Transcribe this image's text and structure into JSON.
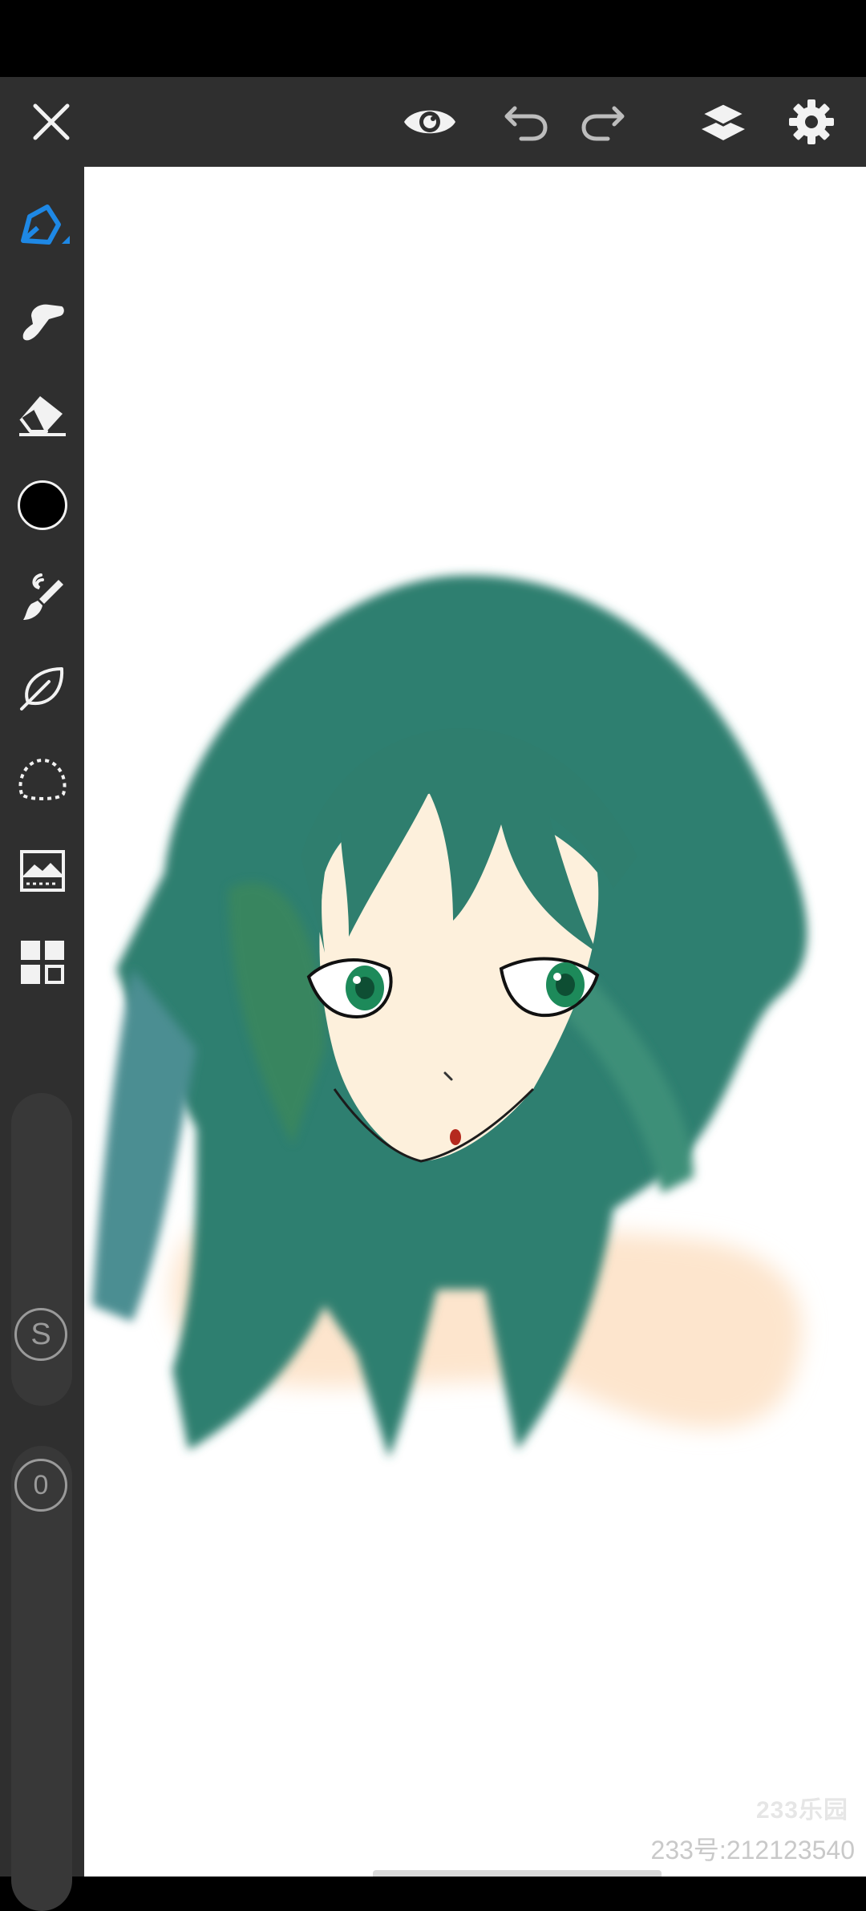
{
  "app": {
    "accent_color": "#1e88e5",
    "current_color": "#000000"
  },
  "top_bar": {
    "icons": [
      "close-icon",
      "eye-icon",
      "undo-icon",
      "redo-icon",
      "layers-icon",
      "gear-icon"
    ]
  },
  "side_tools": {
    "icons": [
      "pencil-icon",
      "smudge-icon",
      "eraser-icon",
      "color-swatch",
      "brush-icon",
      "leaf-icon",
      "lasso-icon",
      "image-adjust-icon",
      "grid-icon"
    ],
    "size_slider": {
      "label": "S"
    },
    "opacity_slider": {
      "label": "0"
    }
  },
  "canvas": {
    "watermark": {
      "logo": "233乐园",
      "id_text": "233号:212123540"
    }
  }
}
